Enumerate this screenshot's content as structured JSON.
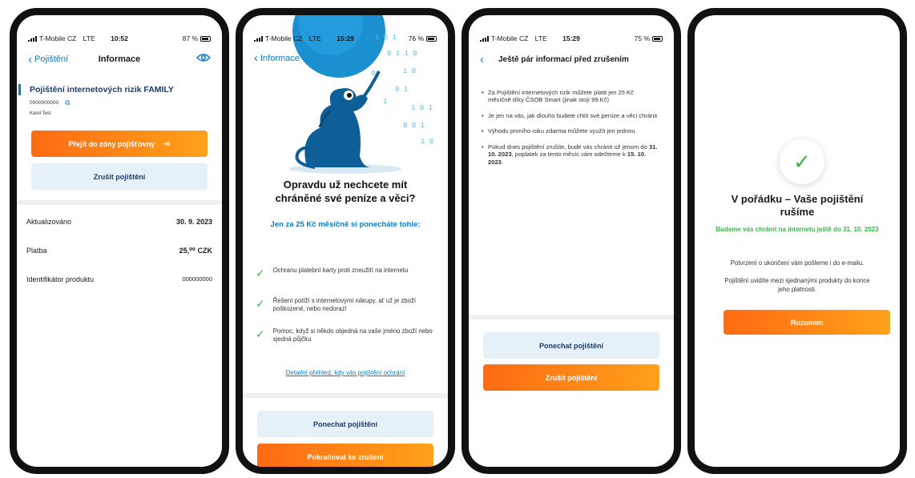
{
  "colors": {
    "accent": "#0d7dc1",
    "orange": "#ff7a12",
    "green": "#3bb54a",
    "light_btn": "#e6f0f7"
  },
  "screen1": {
    "status": {
      "carrier": "T-Mobile CZ",
      "network": "LTE",
      "time": "10:52",
      "battery": "87 %"
    },
    "nav": {
      "back_label": "Pojištění",
      "title": "Informace",
      "eye_icon": "eye-icon"
    },
    "product_name": "Pojištění internetových rizik FAMILY",
    "policy_number": "0000000000",
    "holder": "Karel Test",
    "goto_insurer_label": "Přejít do zóny pojišťovny",
    "cancel_label": "Zrušit pojištění",
    "details": [
      {
        "label": "Aktualizováno",
        "value": "30. 9. 2023"
      },
      {
        "label": "Platba",
        "value": "25,⁰⁰ CZK"
      },
      {
        "label": "Identifikátor produktu",
        "value": "000000000"
      }
    ]
  },
  "screen2": {
    "status": {
      "carrier": "T-Mobile CZ",
      "network": "LTE",
      "time": "15:29",
      "battery": "76 %"
    },
    "nav": {
      "back_label": "Informace"
    },
    "headline": "Opravdu už nechcete mít chráněné své peníze a věci?",
    "subheadline": "Jen za 25 Kč měsíčně si ponecháte tohle:",
    "benefits": [
      "Ochranu platební karty proti zneužití na internetu",
      "Řešení potíží s internetovými nákupy, ať už je zboží poškozené, nebo nedorazí",
      "Pomoc, když si někdo objedná na vaše jméno zboží nebo sjedná půjčku"
    ],
    "detail_link": "Detailní přehled, kdy vás pojištění ochrání",
    "keep_label": "Ponechat pojištění",
    "continue_label": "Pokračovat ke zrušení"
  },
  "screen3": {
    "status": {
      "carrier": "T-Mobile CZ",
      "network": "LTE",
      "time": "15:29",
      "battery": "75 %"
    },
    "nav": {
      "title": "Ještě pár informací před zrušením"
    },
    "items": [
      {
        "text": "Za Pojištění internetových rizik můžete platit jen 25 Kč měsíčně díky ČSOB Smart (jinak stojí 99 Kč)"
      },
      {
        "text": "Je jen na vás, jak dlouho budete chtít své peníze a věci chránit"
      },
      {
        "text": "Výhodu prvního roku zdarma můžete využít jen jednou"
      },
      {
        "pre": "Pokud dnes pojištění zrušíte, bude vás chránit už jenom do ",
        "date1": "31. 10. 2023",
        "mid": ", poplatek za tento měsíc vám odečteme k ",
        "date2": "15. 10. 2023",
        "post": "."
      }
    ],
    "keep_label": "Ponechat pojištění",
    "cancel_label": "Zrušit pojištění"
  },
  "screen4": {
    "title": "V pořádku – Vaše pojištění rušíme",
    "green_text": "Budeme vás chránit na internetu ještě do 31. 10. 2023",
    "line1": "Potvrzení o ukončení vám pošleme i do e-mailu.",
    "line2": "Pojištění uvidíte mezi sjednanými produkty do konce jeho platnosti.",
    "ok_label": "Rozumím"
  }
}
